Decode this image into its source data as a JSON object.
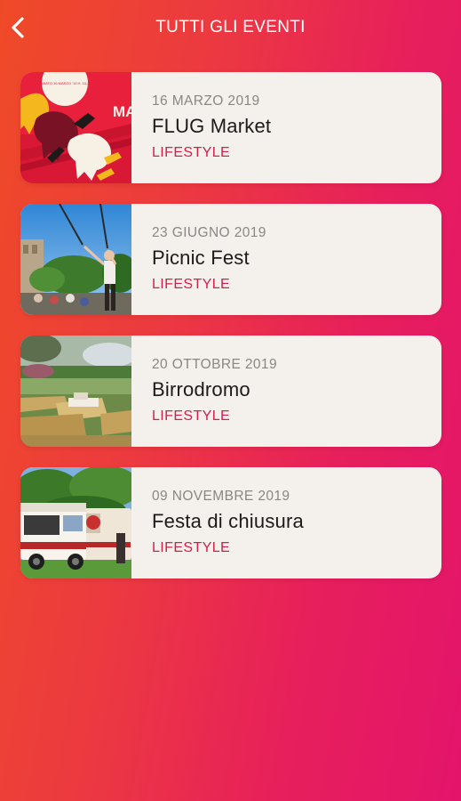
{
  "header": {
    "title": "TUTTI GLI EVENTI"
  },
  "events": [
    {
      "date": "16 MARZO 2019",
      "name": "FLUG Market",
      "category": "LIFESTYLE",
      "thumb_lettering": "MA",
      "thumb_badge": "SABATO 16 MARZO '19 H. 10-22"
    },
    {
      "date": "23 GIUGNO 2019",
      "name": "Picnic Fest",
      "category": "LIFESTYLE"
    },
    {
      "date": "20 OTTOBRE 2019",
      "name": "Birrodromo",
      "category": "LIFESTYLE"
    },
    {
      "date": "09 NOVEMBRE 2019",
      "name": "Festa di chiusura",
      "category": "LIFESTYLE"
    }
  ],
  "colors": {
    "accent": "#d41f4b",
    "card_bg": "#f4f0eb",
    "gradient_left": "#ef4a28",
    "gradient_right": "#e4146b"
  },
  "icons": {
    "back": "chevron-left-icon"
  }
}
